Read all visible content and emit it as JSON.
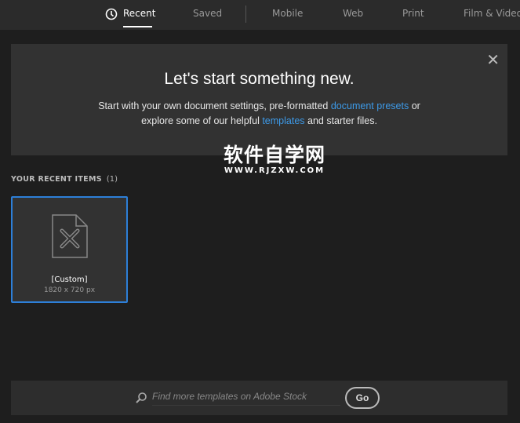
{
  "tabs": [
    {
      "label": "Recent",
      "icon": "clock-icon",
      "active": true
    },
    {
      "label": "Saved"
    },
    {
      "label": "Mobile"
    },
    {
      "label": "Web"
    },
    {
      "label": "Print"
    },
    {
      "label": "Film & Video"
    }
  ],
  "hero": {
    "title": "Let's start something new.",
    "line1_a": "Start with your own document settings, pre-formatted ",
    "link1": "document presets",
    "line1_b": " or",
    "line2_a": "explore some of our helpful ",
    "link2": "templates",
    "line2_b": " and starter files."
  },
  "watermark": {
    "cn": "软件自学网",
    "en": "WWW.RJZXW.COM"
  },
  "recent": {
    "heading": "YOUR RECENT ITEMS",
    "count": "(1)",
    "items": [
      {
        "name": "[Custom]",
        "size": "1820 x 720 px"
      }
    ]
  },
  "search": {
    "placeholder": "Find more templates on Adobe Stock",
    "go": "Go"
  },
  "colors": {
    "accent": "#2d7fd8",
    "link": "#3d9ae8"
  }
}
